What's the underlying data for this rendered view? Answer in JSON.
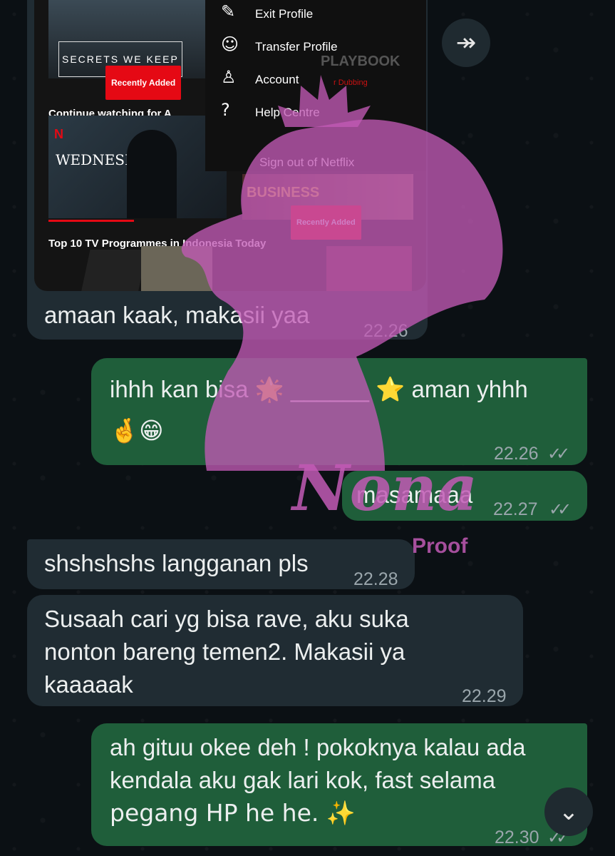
{
  "screenshot": {
    "menu_items": [
      {
        "icon": "pencil-icon",
        "label": "Exit Profile"
      },
      {
        "icon": "transfer-profile-icon",
        "label": "Transfer Profile"
      },
      {
        "icon": "account-icon",
        "label": "Account"
      },
      {
        "icon": "help-icon",
        "label": "Help Centre"
      }
    ],
    "sign_out": "Sign out of Netflix",
    "poster_title_1": "SECRETS WE KEEP",
    "badge_1": "Recently Added",
    "section_continue": "Continue watching for A",
    "poster_title_2": "WEDNESDAY",
    "poster_title_3": "BUSINESS",
    "badge_3": "Recently Added",
    "section_top10": "Top 10 TV Programmes in Indonesia Today",
    "partial_playbook": "PLAYBOOK",
    "partial_dubbing": "r Dubbing"
  },
  "messages": [
    {
      "text": "amaan kaak, makasii yaa",
      "time": "22.26"
    },
    {
      "text_a": "ihhh kan bisa",
      "emoji_a": "🌟",
      "blank": "______",
      "emoji_b": "⭐",
      "text_b": "aman yhhh",
      "line2": "🤞😁",
      "time": "22.26",
      "ticks": "✓✓"
    },
    {
      "text": "masamaaa",
      "time": "22.27",
      "ticks": "✓✓"
    },
    {
      "text": "shshshshs langganan pls",
      "time": "22.28"
    },
    {
      "line1": "Susaah cari yg bisa rave, aku suka",
      "line2": "nonton bareng temen2. Makasii ya",
      "line3": "kaaaaak",
      "time": "22.29"
    },
    {
      "line1": "ah gituu okee deh ! pokoknya kalau ada",
      "line2": "kendala aku gak lari kok, fast selama",
      "line3": "pegang HP he he. ✨",
      "time": "22.30",
      "ticks": "✓✓"
    }
  ],
  "watermark": {
    "text": "Nona",
    "sub": "Proof",
    "color": "#c25ab5"
  },
  "buttons": {
    "forward_icon": "forward-icon",
    "scroll_down_icon": "chevron-double-down-icon"
  }
}
